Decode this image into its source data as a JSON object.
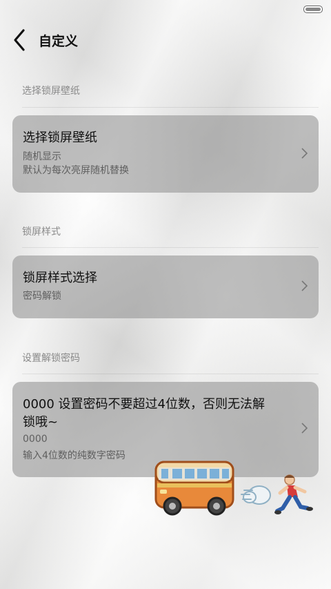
{
  "header": {
    "title": "自定义"
  },
  "sections": [
    {
      "label": "选择锁屏壁纸",
      "card": {
        "title": "选择锁屏壁纸",
        "lines": [
          "随机显示",
          "默认为每次亮屏随机替换"
        ]
      }
    },
    {
      "label": "锁屏样式",
      "card": {
        "title": "锁屏样式选择",
        "lines": [
          "密码解锁"
        ]
      }
    },
    {
      "label": "设置解锁密码",
      "card": {
        "title_line1": "0000  设置密码不要超过4位数，否则无法解",
        "title_line2": "锁哦~",
        "lines": [
          "0000",
          "输入4位数的纯数字密码"
        ]
      }
    }
  ],
  "icons": {
    "back": "back-arrow-icon",
    "chevron": "chevron-right-icon",
    "bus": "bus-icon",
    "dash": "dash-icon",
    "runner": "runner-icon"
  }
}
